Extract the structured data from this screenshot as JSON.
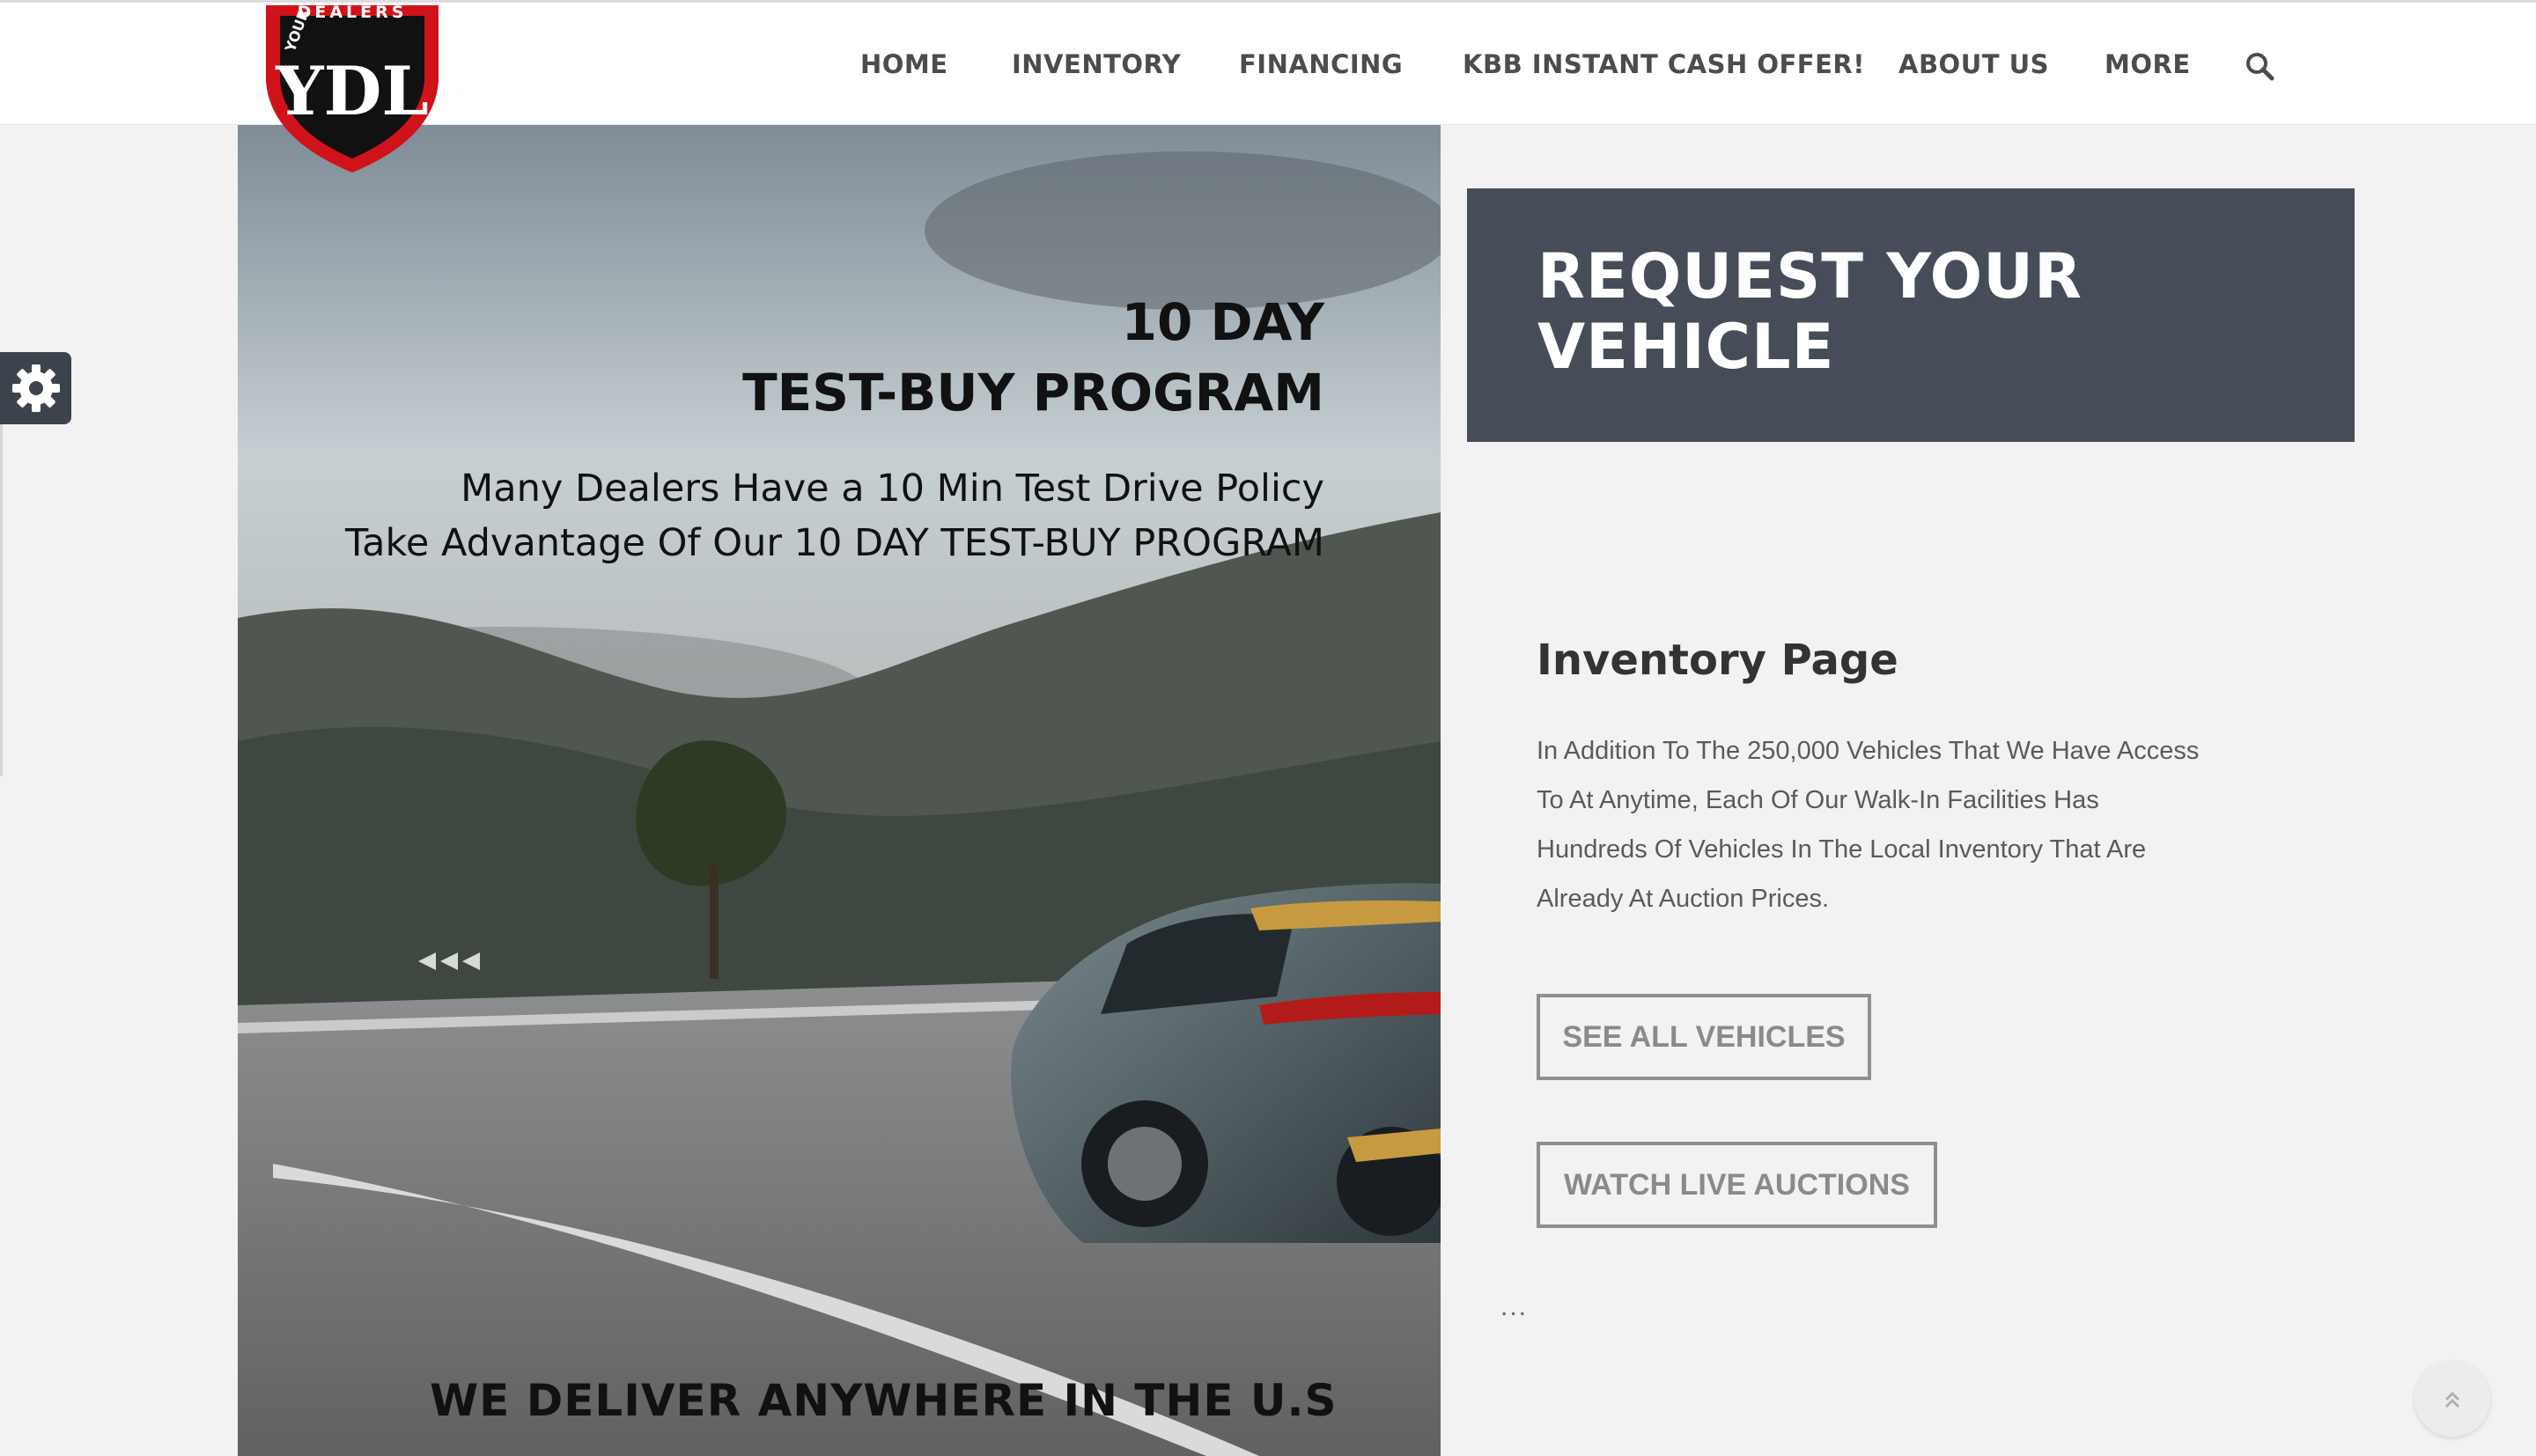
{
  "logo": {
    "top_text": "DEALERS",
    "arc_text": "YOUR",
    "monogram": "YDL"
  },
  "nav": {
    "items": [
      {
        "label": "HOME"
      },
      {
        "label": "INVENTORY"
      },
      {
        "label": "FINANCING"
      },
      {
        "label": "KBB INSTANT CASH OFFER!"
      },
      {
        "label": "ABOUT US"
      },
      {
        "label": "MORE"
      }
    ],
    "search_icon": "search-icon"
  },
  "hero": {
    "title_line1": "10 DAY",
    "title_line2": "TEST-BUY PROGRAM",
    "subtitle_line1": "Many Dealers Have a 10 Min Test Drive Policy",
    "subtitle_line2": "Take Advantage Of Our 10 DAY TEST-BUY PROGRAM",
    "footer": "WE DELIVER ANYWHERE IN THE U.S"
  },
  "request": {
    "title": "REQUEST YOUR VEHICLE"
  },
  "inventory": {
    "heading": "Inventory Page",
    "description": "In Addition To The 250,000 Vehicles That We Have Access To At Anytime, Each Of Our Walk-In Facilities Has Hundreds Of Vehicles In The Local Inventory That Are Already At Auction Prices.",
    "see_all_label": "SEE ALL VEHICLES",
    "watch_auctions_label": "WATCH LIVE AUCTIONS",
    "ellipsis": "..."
  },
  "widgets": {
    "settings_icon": "gear-icon",
    "scroll_icon": "double-chevron-up-icon"
  },
  "colors": {
    "nav_text": "#4c4c4c",
    "request_bg": "#474d58",
    "logo_red": "#d0121b",
    "page_bg": "#f2f2f2"
  }
}
